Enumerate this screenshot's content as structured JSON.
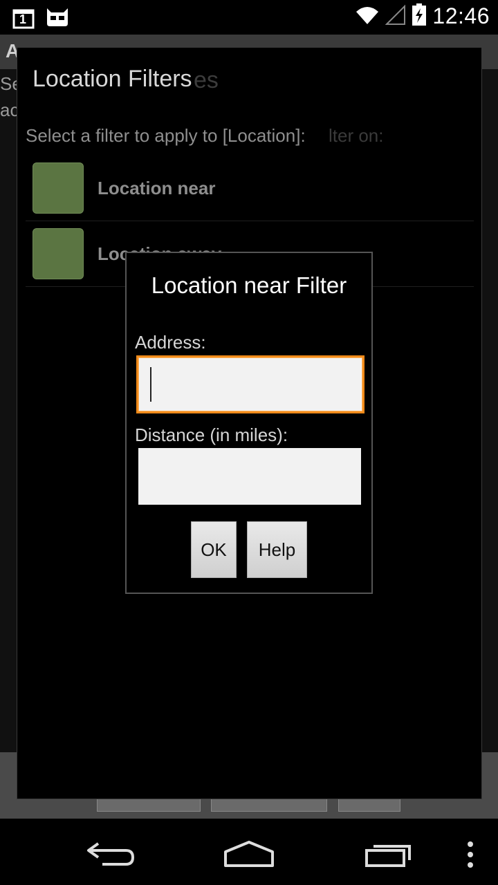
{
  "status_bar": {
    "notification_badge": "1",
    "time": "12:46",
    "icons": [
      "calendar-notification-icon",
      "cyanogenmod-icon",
      "wifi-icon",
      "cell-signal-icon",
      "battery-charging-icon"
    ]
  },
  "background_app": {
    "title": "Add filters to location (partially hidden)",
    "subtext_lines": [
      "Se",
      "ac"
    ]
  },
  "outer_dialog": {
    "title": "Location Filters",
    "prompt": "Select a filter to apply to [Location]:",
    "ghost_title": "es",
    "ghost_prompt": "lter on:",
    "items": [
      {
        "label": "Location near"
      },
      {
        "label": "Location away"
      }
    ]
  },
  "inner_dialog": {
    "title": "Location near Filter",
    "address_label": "Address:",
    "address_value": "",
    "distance_label": "Distance (in miles):",
    "distance_value": "",
    "ok_label": "OK",
    "help_label": "Help"
  },
  "nav_bar": {
    "icons": [
      "back-icon",
      "home-icon",
      "recents-icon",
      "overflow-menu-icon"
    ]
  },
  "colors": {
    "focus_orange": "#f08a1a",
    "swatch_green": "#5b7542"
  }
}
